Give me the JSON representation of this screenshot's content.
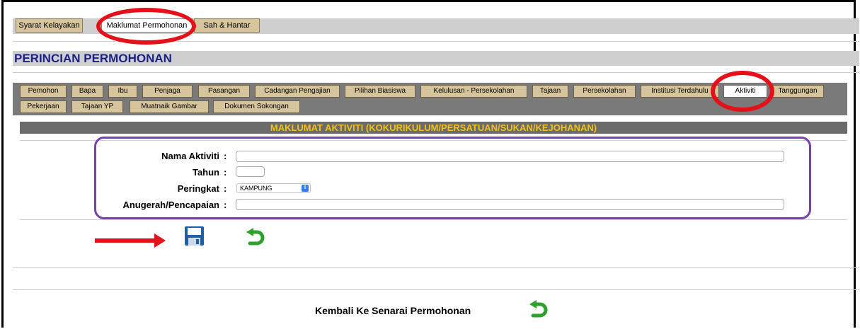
{
  "top_tabs": [
    "Syarat Kelayakan",
    "Maklumat Permohonan",
    "Sah & Hantar"
  ],
  "section_title": "PERINCIAN PERMOHONAN",
  "sub_tabs_row1": [
    "Pemohon",
    "Bapa",
    "Ibu",
    "Penjaga",
    "Pasangan",
    "Cadangan Pengajian",
    "Pilihan Biasiswa",
    "Kelulusan - Persekolahan",
    "Tajaan",
    "Persekolahan",
    "Institusi Terdahulu",
    "Aktiviti",
    "Tanggungan"
  ],
  "sub_tabs_row2": [
    "Pekerjaan",
    "Tajaan YP",
    "Muatnaik Gambar",
    "Dokumen Sokongan"
  ],
  "heading": "MAKLUMAT AKTIVITI (KOKURIKULUM/PERSATUAN/SUKAN/KEJOHANAN)",
  "form": {
    "nama_label": "Nama Aktiviti",
    "tahun_label": "Tahun",
    "peringkat_label": "Peringkat",
    "peringkat_value": "KAMPUNG",
    "anugerah_label": "Anugerah/Pencapaian",
    "colon": ":"
  },
  "footer_link": "Kembali Ke Senarai Permohonan",
  "icons": {
    "save": "floppy-disk-icon",
    "back": "undo-arrow-icon"
  },
  "colors": {
    "tab": "#d6c59c",
    "heading_text": "#f3c11a",
    "title": "#1a1f8a",
    "annotation_red": "#e5101a",
    "annotation_purple": "#7a3fb0"
  }
}
